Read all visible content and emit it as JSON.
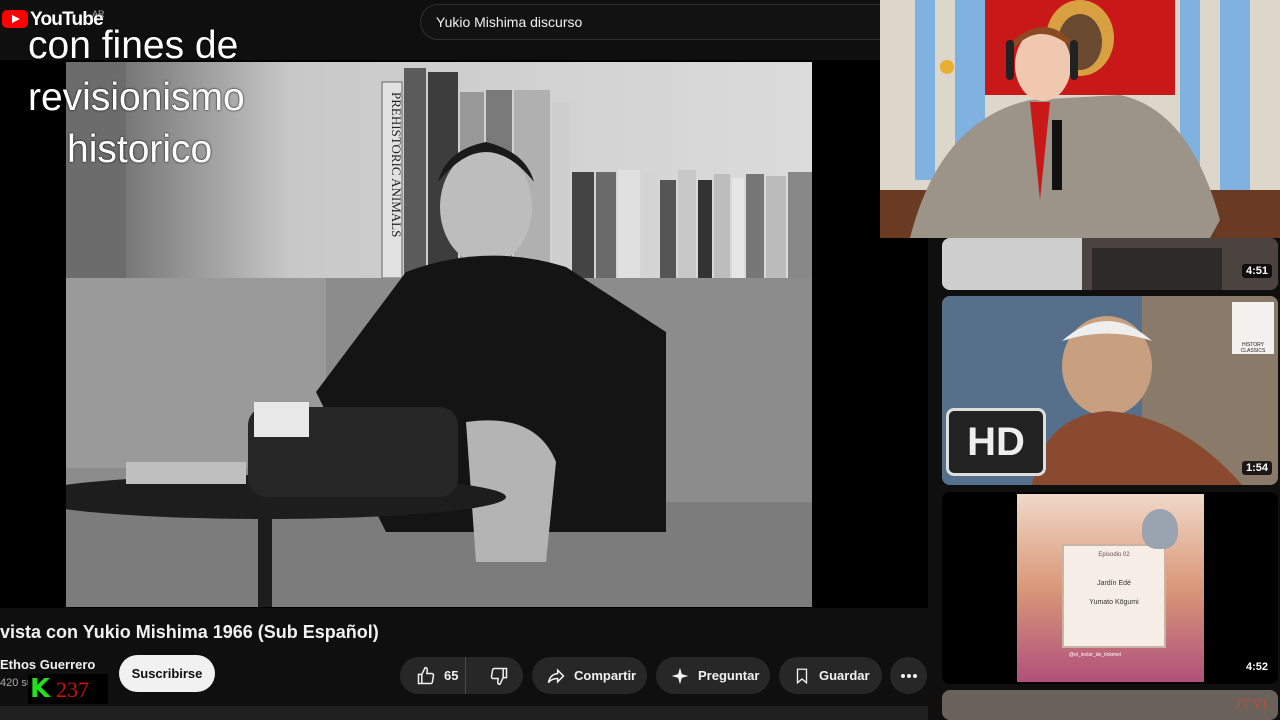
{
  "header": {
    "logo_text": "YouTube",
    "country": "AR",
    "search_value": "Yukio Mishima discurso"
  },
  "overlay": {
    "line1": "con fines de",
    "line2": "revisionismo",
    "line3": "historico"
  },
  "video": {
    "book_spine_text": "PREHISTORIC ANIMALS",
    "title": "vista con Yukio Mishima 1966 (Sub Español)"
  },
  "channel": {
    "name": "Ethos Guerrero",
    "subs_text": "420 suscriptores",
    "subscribe_label": "Suscribirse"
  },
  "kick_badge": {
    "letter": "K",
    "count": "237"
  },
  "actions": {
    "likes": "65",
    "share": "Compartir",
    "ask": "Preguntar",
    "save": "Guardar"
  },
  "recommendations": [
    {
      "duration": "4:51"
    },
    {
      "duration": "1:54",
      "badge": "HD",
      "channel_logo_text": "HISTORY CLASSICS"
    },
    {
      "duration": "4:52",
      "card_text_1": "Episodio 02",
      "card_text_2": "Jardín Edé",
      "card_text_3": "Yumato Kōgumi",
      "handle": "@el_lector_de_tinkimei"
    },
    {
      "duration": "",
      "corner_text": "JT V1"
    }
  ],
  "colors": {
    "brand": "#ff0000",
    "bg": "#0f0f0f",
    "pill": "#272727",
    "kick_green": "#22e01c"
  }
}
